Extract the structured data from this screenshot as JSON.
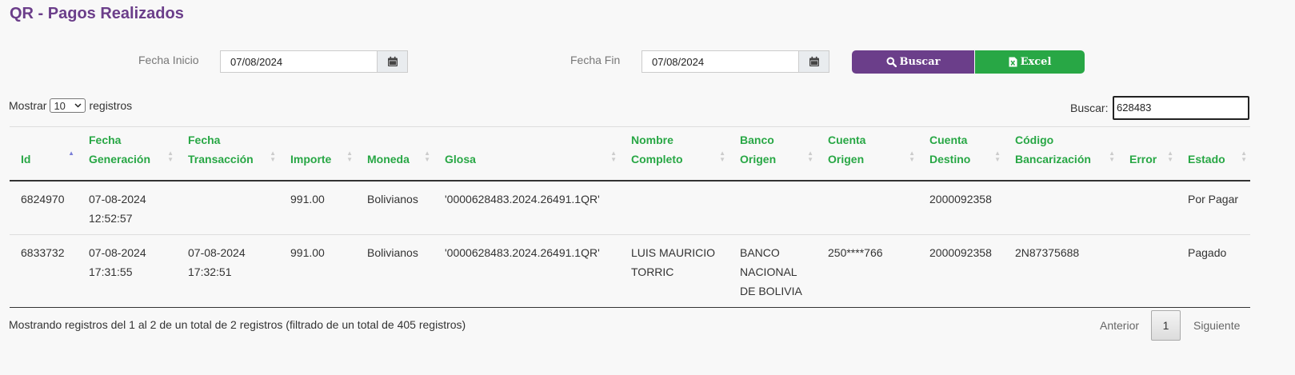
{
  "page": {
    "title": "QR - Pagos Realizados"
  },
  "filters": {
    "fecha_inicio_label": "Fecha Inicio",
    "fecha_inicio_value": "07/08/2024",
    "fecha_fin_label": "Fecha Fin",
    "fecha_fin_value": "07/08/2024",
    "buscar_button": "Buscar",
    "excel_button": "Excel"
  },
  "table_controls": {
    "mostrar_label": "Mostrar",
    "page_size": "10",
    "registros_label": "registros",
    "search_label": "Buscar:",
    "search_value": "628483"
  },
  "table": {
    "columns": [
      [
        "Id"
      ],
      [
        "Fecha",
        "Generación"
      ],
      [
        "Fecha",
        "Transacción"
      ],
      [
        "Importe"
      ],
      [
        "Moneda"
      ],
      [
        "Glosa"
      ],
      [
        "Nombre",
        "Completo"
      ],
      [
        "Banco",
        "Origen"
      ],
      [
        "Cuenta",
        "Origen"
      ],
      [
        "Cuenta",
        "Destino"
      ],
      [
        "Código",
        "Bancarización"
      ],
      [
        "Error"
      ],
      [
        "Estado"
      ]
    ],
    "rows": [
      [
        [
          "6824970"
        ],
        [
          "07-08-2024",
          "12:52:57"
        ],
        [],
        [
          "991.00"
        ],
        [
          "Bolivianos"
        ],
        [
          "'0000628483.2024.26491.1QR'"
        ],
        [],
        [],
        [],
        [
          "2000092358"
        ],
        [],
        [],
        [
          "Por Pagar"
        ]
      ],
      [
        [
          "6833732"
        ],
        [
          "07-08-2024",
          "17:31:55"
        ],
        [
          "07-08-2024",
          "17:32:51"
        ],
        [
          "991.00"
        ],
        [
          "Bolivianos"
        ],
        [
          "'0000628483.2024.26491.1QR'"
        ],
        [
          "LUIS MAURICIO",
          "TORRIC"
        ],
        [
          "BANCO",
          "NACIONAL",
          "DE BOLIVIA"
        ],
        [
          "250****766"
        ],
        [
          "2000092358"
        ],
        [
          "2N87375688"
        ],
        [],
        [
          "Pagado"
        ]
      ]
    ]
  },
  "footer": {
    "info": "Mostrando registros del 1 al 2 de un total de 2 registros (filtrado de un total de 405 registros)",
    "prev": "Anterior",
    "current_page": "1",
    "next": "Siguiente"
  },
  "colors": {
    "brand": "#6b3e8a",
    "accent": "#28a745",
    "header_text": "#28a745"
  },
  "icons": {
    "calendar": "calendar-icon",
    "search": "search-icon",
    "excel": "excel-icon"
  }
}
